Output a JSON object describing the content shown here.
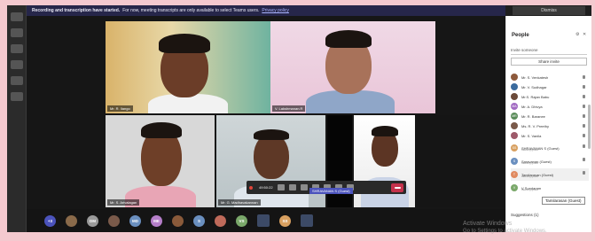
{
  "banner": {
    "bold": "Recording and transcription have started.",
    "text": "For now, meeting transcripts are only available to select Teams users.",
    "link": "Privacy policy",
    "dismiss": "Dismiss"
  },
  "tiles": [
    {
      "name": "Mr. R. Ilango"
    },
    {
      "name": "V. Lakshmanan.R"
    },
    {
      "name": "Mr. S. Arivalagan"
    },
    {
      "name": "Mr. G. Madhavakannan"
    }
  ],
  "controls": {
    "timer": "49:50:22"
  },
  "share_label": "SHRAVANAN S (Guest)",
  "strip": [
    "+3",
    "DM",
    "MD",
    "ME",
    "S",
    "VS",
    "SS"
  ],
  "people": {
    "title": "People",
    "invite": "Invite someone",
    "share": "Share invite",
    "rows": [
      {
        "name": "Mr. S. Venkatesh",
        "color": "#8e5a3c"
      },
      {
        "name": "Mr. V. Sudhagar",
        "color": "#3b6b9e"
      },
      {
        "name": "Mr.S. Rajan Babu",
        "color": "#6b4a3a"
      },
      {
        "name": "Mr. A. Dhivya",
        "initials": "MA",
        "color": "#a16ac2"
      },
      {
        "name": "Mr. R. Baranee",
        "initials": "MR",
        "color": "#5a8c5a"
      },
      {
        "name": "Ms. R. V. Preethy",
        "color": "#7a5a4a"
      },
      {
        "name": "Mr. S. Vanila",
        "color": "#9e5a6a"
      },
      {
        "name": "SHRAVANAN S (Guest)",
        "sub": "Meeting guest",
        "initials": "SS",
        "color": "#d8a060"
      },
      {
        "name": "Saravanan (Guest)",
        "sub": "Meeting guest",
        "initials": "S",
        "color": "#6a8fbf"
      },
      {
        "name": "Tamilarasan (Guest)",
        "sub": "Meeting guest",
        "initials": "T",
        "color": "#e08a60"
      },
      {
        "name": "V Sundaram",
        "sub": "Meeting guest",
        "initials": "V",
        "color": "#7aa86a"
      }
    ],
    "tooltip": "Tamilarasan (Guest)",
    "suggestions": "Suggestions (1)"
  },
  "watermark": {
    "line1": "Activate Windows",
    "line2": "Go to Settings to activate Windows."
  }
}
